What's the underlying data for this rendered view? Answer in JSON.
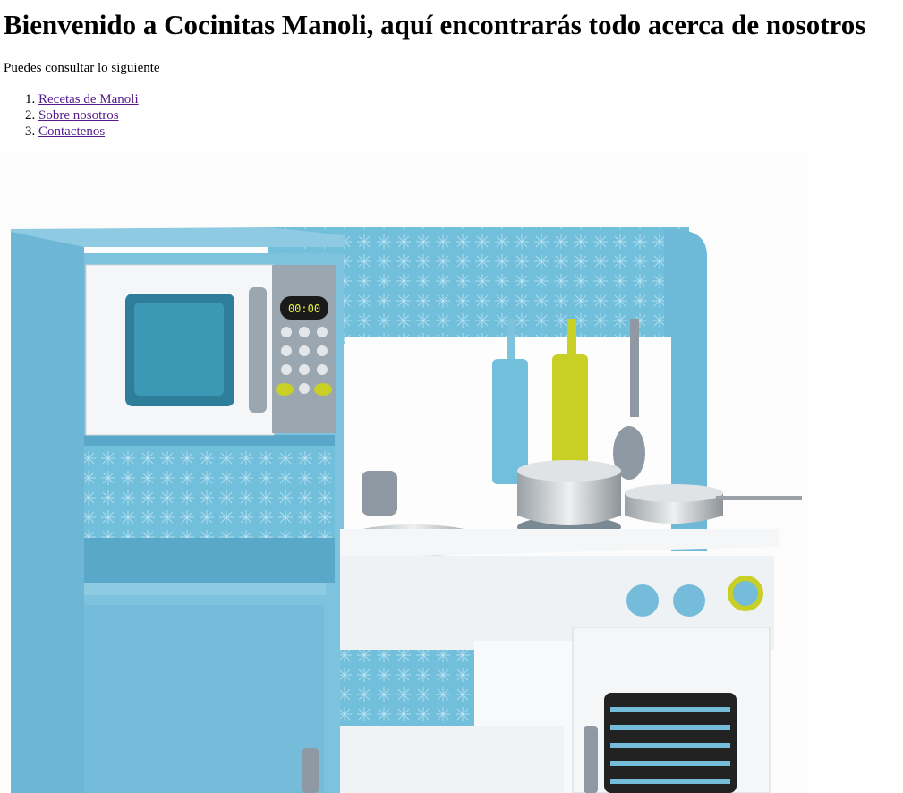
{
  "page": {
    "title": "Bienvenido a Cocinitas Manoli, aquí encontrarás todo acerca de nosotros",
    "intro": "Puedes consultar lo siguiente",
    "links": [
      {
        "label": "Recetas de Manoli"
      },
      {
        "label": "Sobre nosotros"
      },
      {
        "label": "Contactenos"
      }
    ]
  },
  "image": {
    "subject": "toy-kitchen-photo",
    "microwave_display": "00:00",
    "colors": {
      "wood": "#7ec3de",
      "wood_dark": "#5aa8c9",
      "white": "#f4f6f7",
      "steel": "#c5c9cc",
      "lime": "#c8cf25",
      "grey": "#8e99a3"
    }
  }
}
